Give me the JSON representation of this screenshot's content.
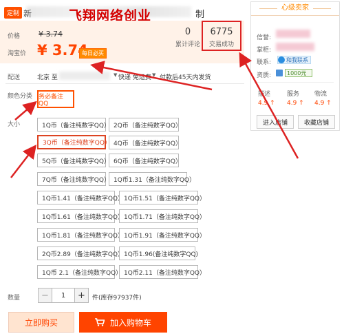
{
  "header": {
    "tag": "定制",
    "title_prefix": "新",
    "title_suffix": "制",
    "watermark": "飞翔网络创业"
  },
  "price": {
    "label": "价格",
    "original": "¥ 3.74",
    "taobao_label": "淘宝价",
    "current": "¥ 3.74",
    "badge": "每日必买",
    "reviews_count": "0",
    "reviews_label": "累计评论",
    "deals_count": "6775",
    "deals_label": "交易成功"
  },
  "shipping": {
    "label": "配送",
    "destination": "北京 至",
    "express": "快递 免运费",
    "refund": "付款后45天内发货"
  },
  "color": {
    "label": "颜色分类",
    "option": "务必备注QQ"
  },
  "size": {
    "label": "大小",
    "options": [
      "1Q币（备注纯数字QQ）",
      "2Q币（备注纯数字QQ）",
      "3Q币（备注纯数字QQ）",
      "4Q币（备注纯数字QQ）",
      "5Q币（备注纯数字QQ）",
      "6Q币（备注纯数字QQ）",
      "7Q币（备注纯数字QQ）",
      "1Q币1.31（备注纯数字QQ）",
      "1Q币1.41（备注纯数字QQ）",
      "1Q币1.51（备注纯数字QQ）",
      "1Q币1.61（备注纯数字QQ）",
      "1Q币1.71（备注纯数字QQ）",
      "1Q币1.81（备注纯数字QQ）",
      "1Q币1.91（备注纯数字QQ）",
      "2Q币2.89（备注纯数字QQ）",
      "1Q币1.96(备注纯数字QQ)",
      "1Q币 2.1（备注纯数字QQ）",
      "1Q币2.11（备注纯数字QQ）"
    ],
    "selected": "3Q币（备注纯数字QQ）"
  },
  "quantity": {
    "label": "数量",
    "minus": "−",
    "value": "1",
    "plus": "+",
    "stock": "件(库存97937件)"
  },
  "actions": {
    "buy_now": "立即购买",
    "add_to_cart": "加入购物车",
    "cart_icon": "cart-icon"
  },
  "shop": {
    "heading": "心级卖家",
    "credit_label": "信誉:",
    "owner_label": "掌柜:",
    "contact_label": "联系:",
    "contact_btn": "和我联系",
    "cert_label": "资质:",
    "cert_value": "1000元",
    "scores": [
      {
        "label": "描述",
        "value": "4.9 ↑"
      },
      {
        "label": "服务",
        "value": "4.9 ↑"
      },
      {
        "label": "物流",
        "value": "4.9 ↑"
      }
    ],
    "enter_shop": "进入店铺",
    "favorite_shop": "收藏店铺"
  },
  "colors": {
    "accent": "#ff4400",
    "annotation_red": "#dd2222"
  }
}
